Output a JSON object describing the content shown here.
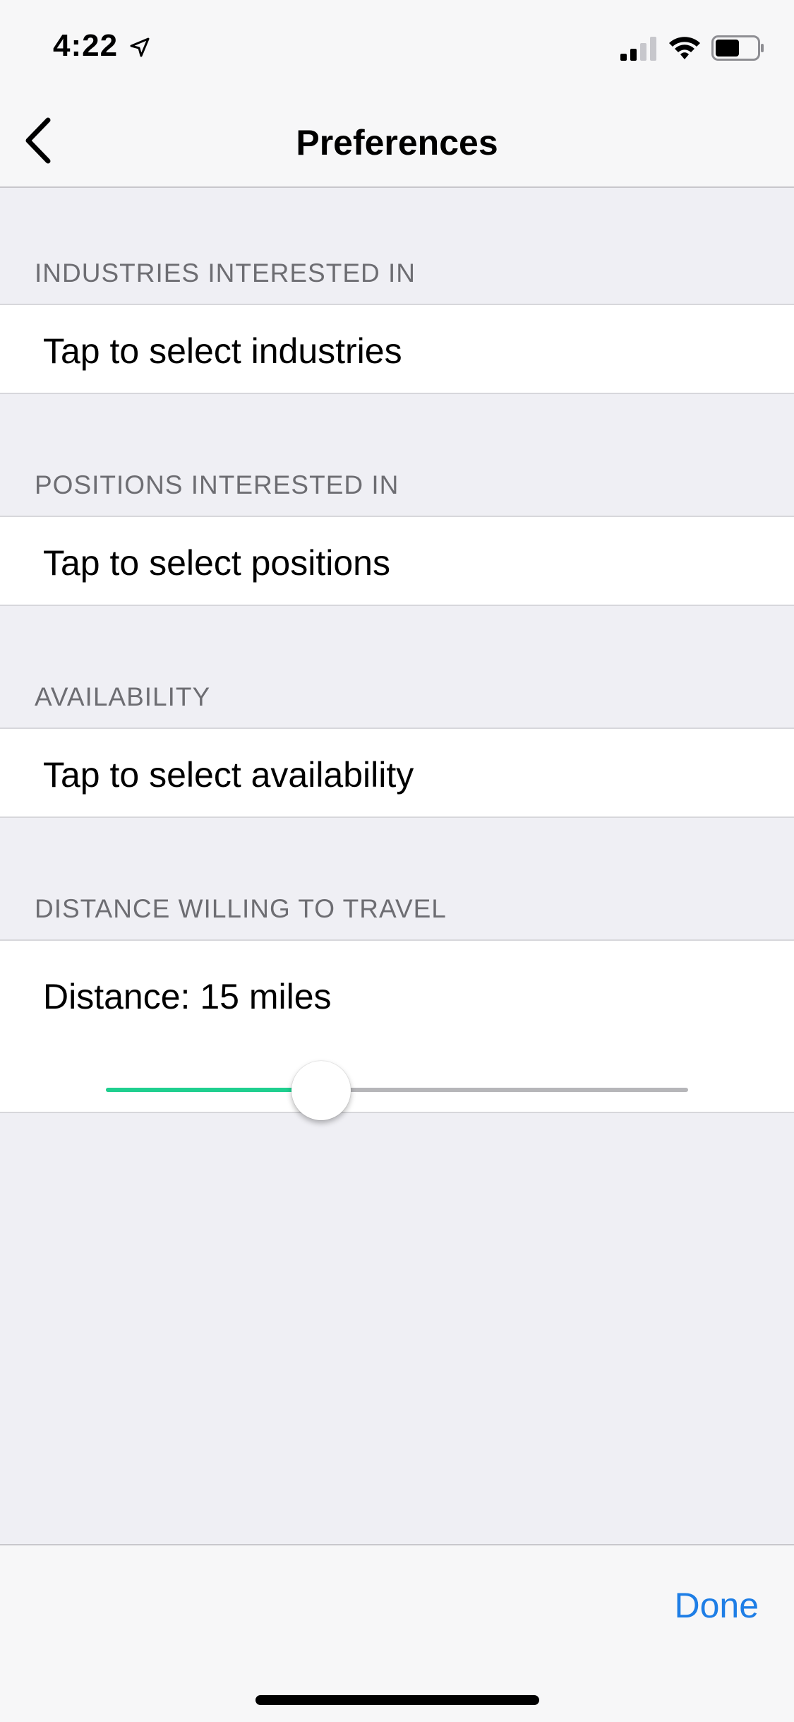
{
  "status_bar": {
    "time": "4:22",
    "icons": [
      "location-arrow-icon",
      "cellular-signal-icon",
      "wifi-icon",
      "battery-icon"
    ]
  },
  "nav": {
    "title": "Preferences",
    "back_icon": "chevron-left-icon"
  },
  "sections": {
    "industries": {
      "header": "INDUSTRIES INTERESTED IN",
      "cell": "Tap to select industries"
    },
    "positions": {
      "header": "POSITIONS INTERESTED IN",
      "cell": "Tap to select positions"
    },
    "availability": {
      "header": "AVAILABILITY",
      "cell": "Tap to select availability"
    },
    "distance": {
      "header": "DISTANCE WILLING TO TRAVEL",
      "label": "Distance: 15 miles",
      "slider_fraction": 0.37
    }
  },
  "toolbar": {
    "done_label": "Done"
  },
  "colors": {
    "accent": "#1e7ee6",
    "slider_fill": "#1fcf8f",
    "background": "#efeff4"
  }
}
